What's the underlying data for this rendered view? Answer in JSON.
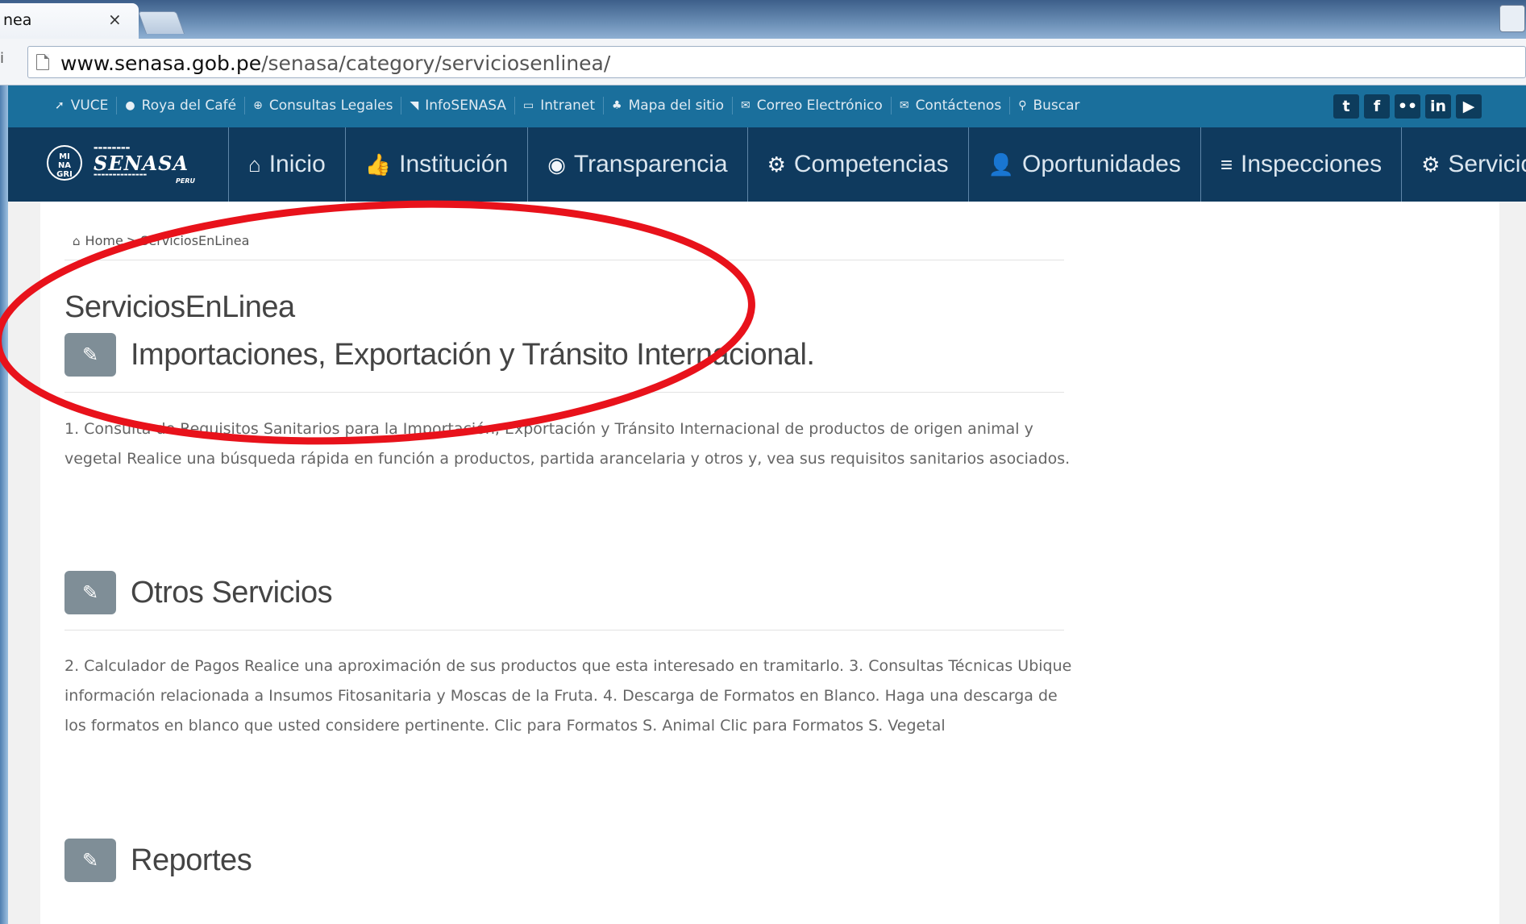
{
  "browser": {
    "tab_title": "nea",
    "tab_close": "×",
    "url_host": "www.senasa.gob.pe",
    "url_path": "/senasa/category/serviciosenlinea/"
  },
  "topbar": {
    "links": [
      {
        "icon": "paper-plane-icon",
        "glyph": "➚",
        "label": "VUCE"
      },
      {
        "icon": "globe-icon",
        "glyph": "●",
        "label": "Roya del Café"
      },
      {
        "icon": "search-plus-icon",
        "glyph": "⊕",
        "label": "Consultas Legales"
      },
      {
        "icon": "rss-icon",
        "glyph": "◥",
        "label": "InfoSENASA"
      },
      {
        "icon": "credit-card-icon",
        "glyph": "▭",
        "label": "Intranet"
      },
      {
        "icon": "sitemap-icon",
        "glyph": "♣",
        "label": "Mapa del sitio"
      },
      {
        "icon": "chat-icon",
        "glyph": "✉",
        "label": "Correo Electrónico"
      },
      {
        "icon": "envelope-icon",
        "glyph": "✉",
        "label": "Contáctenos"
      },
      {
        "icon": "search-icon",
        "glyph": "⚲",
        "label": "Buscar"
      }
    ],
    "social": [
      {
        "icon": "twitter-icon",
        "glyph": "t"
      },
      {
        "icon": "facebook-icon",
        "glyph": "f"
      },
      {
        "icon": "flickr-icon",
        "glyph": "••"
      },
      {
        "icon": "linkedin-icon",
        "glyph": "in"
      },
      {
        "icon": "youtube-icon",
        "glyph": "▶"
      }
    ]
  },
  "logo": {
    "circle": "MI NA GRI",
    "name": "SENASA",
    "country": "PERU"
  },
  "nav": {
    "items": [
      {
        "icon": "home-icon",
        "glyph": "⌂",
        "label": "Inicio"
      },
      {
        "icon": "thumbs-up-icon",
        "glyph": "👍",
        "label": "Institución"
      },
      {
        "icon": "eye-icon",
        "glyph": "◉",
        "label": "Transparencia"
      },
      {
        "icon": "gear-icon",
        "glyph": "⚙",
        "label": "Competencias"
      },
      {
        "icon": "user-plus-icon",
        "glyph": "👤",
        "label": "Oportunidades"
      },
      {
        "icon": "menu-icon",
        "glyph": "≡",
        "label": "Inspecciones"
      },
      {
        "icon": "gears-icon",
        "glyph": "⚙",
        "label": "Servicios"
      }
    ]
  },
  "breadcrumb": {
    "home": "Home",
    "separator": ">",
    "current": "ServiciosEnLinea"
  },
  "main": {
    "title": "ServiciosEnLinea",
    "sections": [
      {
        "title": "Importaciones, Exportación y Tránsito Internacional.",
        "body": "1. Consulta de Requisitos Sanitarios para la Importación, Exportación y Tránsito Internacional de productos de origen animal y vegetal Realice una búsqueda rápida en función a productos, partida arancelaria y otros y, vea sus requisitos sanitarios asociados."
      },
      {
        "title": "Otros Servicios",
        "body": "2. Calculador de Pagos Realice una aproximación de sus productos que esta interesado en tramitarlo. 3. Consultas Técnicas Ubique información relacionada a Insumos Fitosanitaria y Moscas de la Fruta. 4. Descarga de Formatos en Blanco. Haga una descarga de los formatos en blanco que usted considere pertinente. Clic para Formatos S. Animal Clic para Formatos S. Vegetal"
      },
      {
        "title": "Reportes",
        "body": ""
      }
    ]
  },
  "colors": {
    "topbar": "#1a6f9c",
    "mainnav": "#0f3a5e",
    "badge": "#7f8e97",
    "annotation": "#e8121b"
  }
}
